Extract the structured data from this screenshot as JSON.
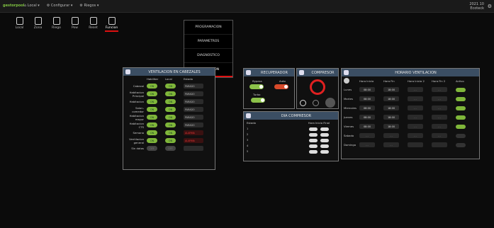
{
  "app": {
    "logo": "gestorpool",
    "nav": [
      "⌂ Local ▾",
      "⚙ Configurar ▾",
      "⚙ Riegos ▾"
    ],
    "date": "2021 10",
    "time": "Ecoteck",
    "settings_icon": "gear-icon"
  },
  "iconbar": [
    {
      "label": "Local",
      "icon": "home-icon"
    },
    {
      "label": "Zona",
      "icon": "zone-icon"
    },
    {
      "label": "Riego",
      "icon": "drop-icon"
    },
    {
      "label": "Pow",
      "icon": "power-icon"
    },
    {
      "label": "Reset",
      "icon": "reset-icon"
    },
    {
      "label": "Funcion",
      "icon": "function-icon",
      "selected": true
    }
  ],
  "menu": {
    "items": [
      "PROGRAMACION",
      "PARAMETROS",
      "DIAGNOSTICO",
      "VENTILACION"
    ],
    "active_index": 3
  },
  "ventilation": {
    "title": "VENTILACION EN CABEZALES",
    "columns": [
      "Habilitar",
      "Local",
      "Estado"
    ],
    "rows": [
      {
        "name": "Cabezal",
        "a": "ON",
        "b": "ON",
        "status": "PARADO"
      },
      {
        "name": "Habitacion Principal",
        "a": "ON",
        "b": "ON",
        "status": "PARADO"
      },
      {
        "name": "Habitacion",
        "a": "ON",
        "b": "ON",
        "status": "PARADO"
      },
      {
        "name": "Salon-comedor",
        "a": "ON",
        "b": "ON",
        "status": "PARADO"
      },
      {
        "name": "Habitacion mayor",
        "a": "ON",
        "b": "ON",
        "status": "PARADO"
      },
      {
        "name": "Habitacion CTS",
        "a": "ON",
        "b": "ON",
        "status": "PARADO"
      },
      {
        "name": "Semana",
        "a": "ON",
        "b": "ON",
        "status": "ALARMA",
        "alarm": true
      },
      {
        "name": "Ventilacion general",
        "a": "ON",
        "b": "ON",
        "status": "ALARMA",
        "alarm": true
      },
      {
        "name": "Sin datos",
        "a": "OFF",
        "b": "OFF",
        "status": ""
      }
    ]
  },
  "recuperador": {
    "title": "RECUPERADOR",
    "labels": [
      "Bypass",
      "Auto",
      "Turbo"
    ]
  },
  "compresor": {
    "title": "COMPRESOR"
  },
  "daily": {
    "title": "DIA COMPRESOR",
    "col_left": "Estado",
    "col_right": "Hora Inicio  Final",
    "rows": [
      "1",
      "2",
      "3",
      "4",
      "5"
    ]
  },
  "schedule": {
    "title": "HORARIO VENTILACION",
    "columns": [
      "Hora Inicio",
      "Hora Fin",
      "Hora Inicio 2",
      "Hora Fin 2",
      "Activo"
    ],
    "rows": [
      {
        "day": "Lunes",
        "start": "08:00",
        "end": "18:00",
        "s2": "- -",
        "e2": "- -",
        "on": true
      },
      {
        "day": "Martes",
        "start": "08:00",
        "end": "18:00",
        "s2": "- -",
        "e2": "- -",
        "on": true
      },
      {
        "day": "Miercoles",
        "start": "08:00",
        "end": "18:00",
        "s2": "- -",
        "e2": "- -",
        "on": true
      },
      {
        "day": "Jueves",
        "start": "08:00",
        "end": "18:00",
        "s2": "- -",
        "e2": "- -",
        "on": true
      },
      {
        "day": "Viernes",
        "start": "08:00",
        "end": "18:00",
        "s2": "- -",
        "e2": "- -",
        "on": true
      },
      {
        "day": "Sabado",
        "start": "- -",
        "end": "- -",
        "s2": "- -",
        "e2": "- -",
        "on": false
      },
      {
        "day": "Domingo",
        "start": "- -",
        "end": "- -",
        "s2": "",
        "e2": "",
        "on": false
      }
    ]
  }
}
